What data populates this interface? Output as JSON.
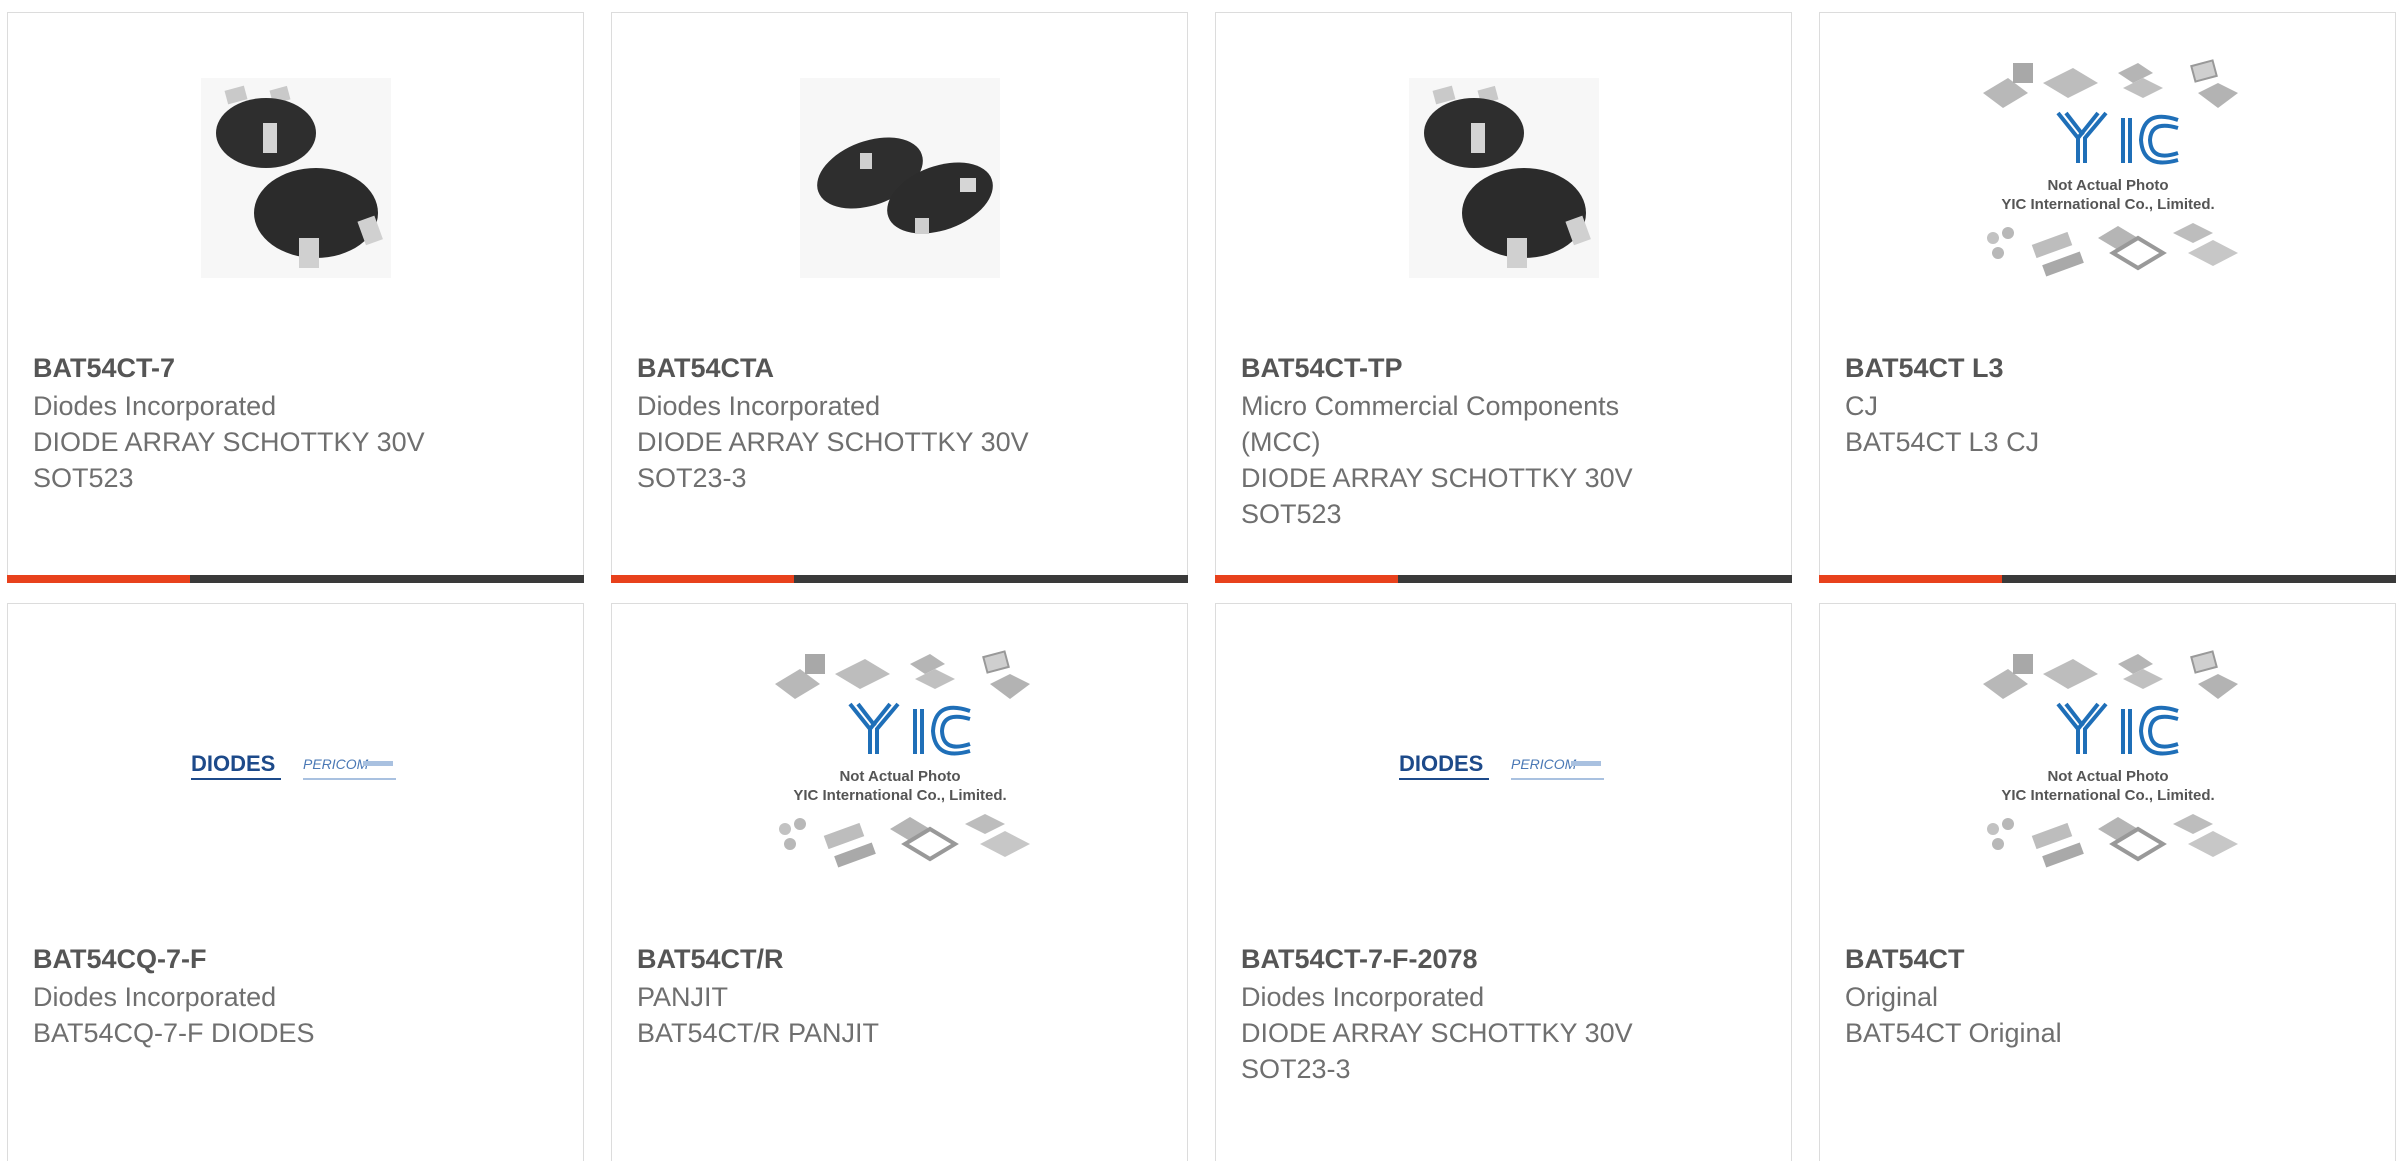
{
  "accent_color": "#e8411c",
  "bar_color": "#3a3a3a",
  "cards": [
    {
      "part": "BAT54CT-7",
      "manufacturer": "Diodes Incorporated",
      "desc1": "DIODE ARRAY SCHOTTKY 30V",
      "desc2": "SOT523",
      "image": "sot523-package-photo"
    },
    {
      "part": "BAT54CTA",
      "manufacturer": "Diodes Incorporated",
      "desc1": "DIODE ARRAY SCHOTTKY 30V",
      "desc2": "SOT23-3",
      "image": "sot23-package-photo"
    },
    {
      "part": "BAT54CT-TP",
      "manufacturer": "Micro Commercial Components",
      "manufacturer2": "(MCC)",
      "desc1": "DIODE ARRAY SCHOTTKY 30V",
      "desc2": "SOT523",
      "image": "sot523-package-photo"
    },
    {
      "part": "BAT54CT L3",
      "manufacturer": "CJ",
      "desc1": "BAT54CT L3 CJ",
      "image": "yic-placeholder",
      "placeholder_line1": "Not Actual Photo",
      "placeholder_line2": "YIC International Co., Limited."
    },
    {
      "part": "BAT54CQ-7-F",
      "manufacturer": "Diodes Incorporated",
      "desc1": "BAT54CQ-7-F DIODES",
      "image": "diodes-pericom-logo",
      "logo_text": "DIODES",
      "logo_text2": "PERICOM"
    },
    {
      "part": "BAT54CT/R",
      "manufacturer": "PANJIT",
      "desc1": "BAT54CT/R PANJIT",
      "image": "yic-placeholder",
      "placeholder_line1": "Not Actual Photo",
      "placeholder_line2": "YIC International Co., Limited."
    },
    {
      "part": "BAT54CT-7-F-2078",
      "manufacturer": "Diodes Incorporated",
      "desc1": "DIODE ARRAY SCHOTTKY 30V",
      "desc2": "SOT23-3",
      "image": "diodes-pericom-logo",
      "logo_text": "DIODES",
      "logo_text2": "PERICOM"
    },
    {
      "part": "BAT54CT",
      "manufacturer": "Original",
      "desc1": "BAT54CT Original",
      "image": "yic-placeholder",
      "placeholder_line1": "Not Actual Photo",
      "placeholder_line2": "YIC International Co., Limited."
    }
  ]
}
